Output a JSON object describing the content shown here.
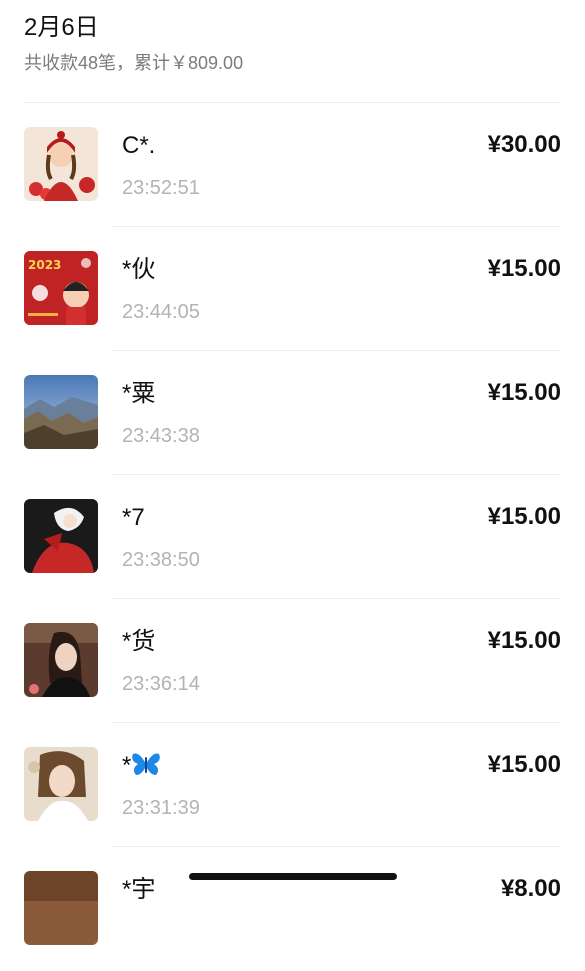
{
  "header": {
    "date": "2月6日",
    "summary": "共收款48笔，累计￥809.00"
  },
  "transactions": [
    {
      "name": "C*.",
      "time": "23:52:51",
      "amount": "¥30.00",
      "avatar": "red-winter-girl-illustration"
    },
    {
      "name": "*伙",
      "time": "23:44:05",
      "amount": "¥15.00",
      "avatar": "2023-new-year-couple-card"
    },
    {
      "name": "*粟",
      "time": "23:43:38",
      "amount": "¥15.00",
      "avatar": "mountain-landscape-photo"
    },
    {
      "name": "*7",
      "time": "23:38:50",
      "amount": "¥15.00",
      "avatar": "anime-figure-in-red"
    },
    {
      "name": "*货",
      "time": "23:36:14",
      "amount": "¥15.00",
      "avatar": "portrait-photo"
    },
    {
      "name": "*",
      "time": "23:31:39",
      "amount": "¥15.00",
      "avatar": "portrait-photo",
      "name_icon": "butterfly-icon"
    },
    {
      "name": "*宇",
      "time": "",
      "amount": "¥8.00",
      "avatar": "portrait-photo"
    }
  ],
  "colors": {
    "primary_text": "#111111",
    "secondary_text": "#7b7b7b",
    "time_text": "#b3b3b3",
    "separator": "#eeeeee",
    "butterfly": "#1e88e5"
  }
}
